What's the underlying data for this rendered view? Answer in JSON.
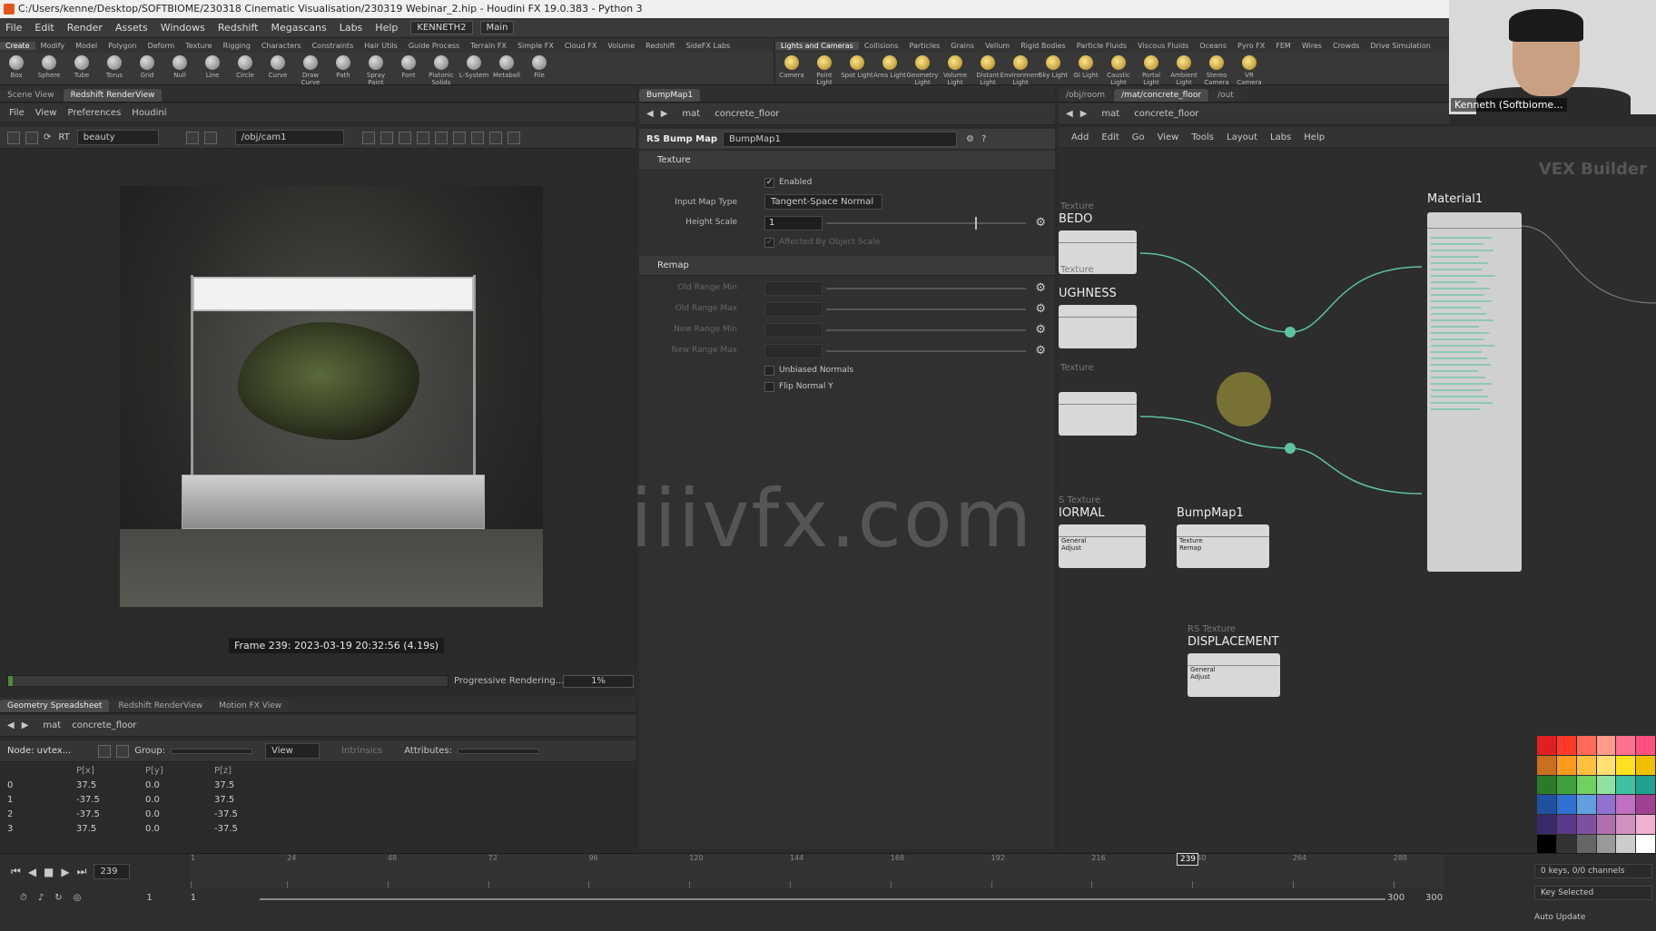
{
  "window": {
    "title": "C:/Users/kenne/Desktop/SOFTBIOME/230318 Cinematic Visualisation/230319 Webinar_2.hip - Houdini FX 19.0.383 - Python 3"
  },
  "menubar": {
    "items": [
      "File",
      "Edit",
      "Render",
      "Assets",
      "Windows",
      "Redshift",
      "Megascans",
      "Labs",
      "Help"
    ],
    "desk": "KENNETH2",
    "desk2": "Main"
  },
  "shelf_left": {
    "tabs": [
      "Create",
      "Modify",
      "Model",
      "Polygon",
      "Deform",
      "Texture",
      "Rigging",
      "Characters",
      "Constraints",
      "Hair Utils",
      "Guide Process",
      "Terrain FX",
      "Simple FX",
      "Cloud FX",
      "Volume",
      "Redshift",
      "SideFX Labs"
    ],
    "tools": [
      "Box",
      "Sphere",
      "Tube",
      "Torus",
      "Grid",
      "Null",
      "Line",
      "Circle",
      "Curve",
      "Draw Curve",
      "Path",
      "Spray Paint",
      "Font",
      "Platonic Solids",
      "L-System",
      "Metaball",
      "File"
    ]
  },
  "shelf_right": {
    "tabs": [
      "Lights and Cameras",
      "Collisions",
      "Particles",
      "Grains",
      "Vellum",
      "Rigid Bodies",
      "Particle Fluids",
      "Viscous Fluids",
      "Oceans",
      "Pyro FX",
      "FEM",
      "Wires",
      "Crowds",
      "Drive Simulation"
    ],
    "tools": [
      "Camera",
      "Point Light",
      "Spot Light",
      "Area Light",
      "Geometry Light",
      "Volume Light",
      "Distant Light",
      "Environment Light",
      "Sky Light",
      "GI Light",
      "Caustic Light",
      "Portal Light",
      "Ambient Light",
      "Stereo Camera",
      "VR Camera"
    ]
  },
  "left_panel": {
    "tabs": [
      "Scene View",
      "Redshift RenderView"
    ],
    "menu": [
      "File",
      "View",
      "Preferences",
      "Houdini"
    ],
    "aov": "beauty",
    "camera": "/obj/cam1",
    "frame_label": "Frame 239: 2023-03-19 20:32:56 (4.19s)",
    "progress_label": "Progressive Rendering...",
    "progress_pct": "1%",
    "progress_value": 0.01
  },
  "mid_panel": {
    "tab": "BumpMap1",
    "path_a": "mat",
    "path_b": "concrete_floor",
    "node_type": "RS Bump Map",
    "node_name": "BumpMap1",
    "section_texture": "Texture",
    "enabled_label": "Enabled",
    "input_map_type_label": "Input Map Type",
    "input_map_type_value": "Tangent-Space Normal",
    "height_scale_label": "Height Scale",
    "height_scale_value": "1",
    "affected_label": "Affected By Object Scale",
    "section_remap": "Remap",
    "old_min": "Old Range Min",
    "old_max": "Old Range Max",
    "new_min": "New Range Min",
    "new_max": "New Range Max",
    "unbiased": "Unbiased Normals",
    "flip": "Flip Normal Y"
  },
  "right_panel": {
    "tabs": [
      "/obj/room",
      "/mat/concrete_floor",
      "/out"
    ],
    "path_a": "mat",
    "path_b": "concrete_floor",
    "menu": [
      "Add",
      "Edit",
      "Go",
      "View",
      "Tools",
      "Layout",
      "Labs",
      "Help"
    ],
    "watermark": "VEX Builder",
    "material_label": "Material1",
    "nodes": {
      "albedo_sub": "Texture",
      "albedo": "BEDO",
      "rough_sub": "Texture",
      "rough": "UGHNESS",
      "tex3_sub": "Texture",
      "normal_sub": "S Texture",
      "normal": "IORMAL",
      "bump": "BumpMap1",
      "disp_sub": "RS Texture",
      "disp": "DISPLACEMENT"
    },
    "bump_ports": [
      "Texture",
      "Remap"
    ],
    "disp_ports": [
      "General",
      "Adjust"
    ],
    "normal_ports": [
      "General",
      "Adjust"
    ]
  },
  "spreadsheet": {
    "tabs": [
      "Geometry Spreadsheet",
      "Redshift RenderView",
      "Motion FX View"
    ],
    "path_a": "mat",
    "path_b": "concrete_floor",
    "node_label": "Node: uvtex...",
    "group_label": "Group:",
    "view_label": "View",
    "intrinsics": "Intrinsics",
    "attr_label": "Attributes:",
    "headers": [
      "",
      "P[x]",
      "P[y]",
      "P[z]"
    ],
    "rows": [
      [
        "0",
        "37.5",
        "0.0",
        "37.5"
      ],
      [
        "1",
        "-37.5",
        "0.0",
        "37.5"
      ],
      [
        "2",
        "-37.5",
        "0.0",
        "-37.5"
      ],
      [
        "3",
        "37.5",
        "0.0",
        "-37.5"
      ]
    ]
  },
  "timeline": {
    "frame": "239",
    "start": "1",
    "start2": "1",
    "end": "300",
    "end2": "300",
    "ticks": [
      "1",
      "24",
      "48",
      "72",
      "96",
      "120",
      "144",
      "168",
      "192",
      "216",
      "240",
      "264",
      "288"
    ],
    "current": "239",
    "keys": "0 keys, 0/0 channels",
    "key_selected": "Key Selected",
    "auto_update": "Auto Update"
  },
  "webcam": {
    "name": "Kenneth (Softbiome..."
  },
  "overlay": {
    "watermark": "iiivfx.com"
  },
  "colors": {
    "accent": "#e2561c",
    "wire": "#5fc3a0"
  }
}
